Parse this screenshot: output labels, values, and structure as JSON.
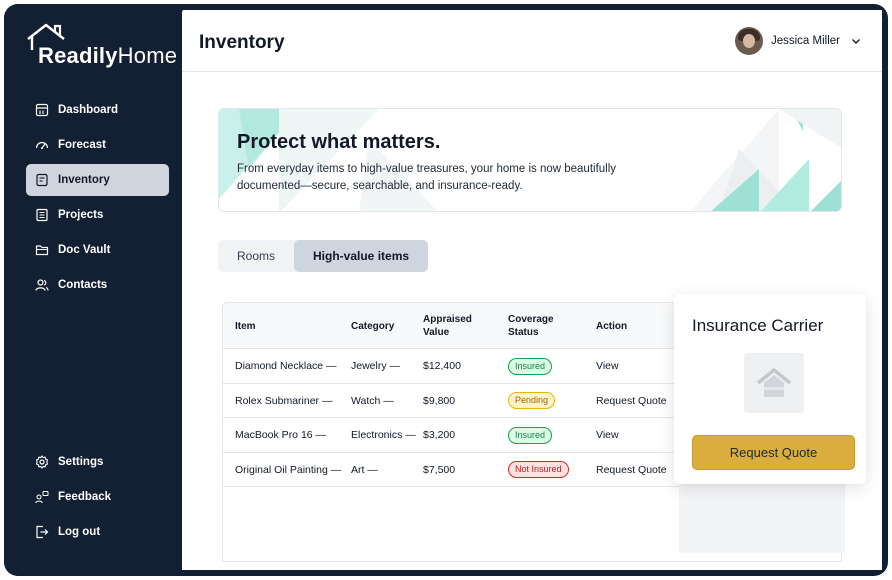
{
  "app": {
    "logo_text_bold": "Readily",
    "logo_text_light": "Home"
  },
  "sidebar": {
    "items": [
      {
        "label": "Dashboard",
        "icon": "calendar-icon",
        "active": false
      },
      {
        "label": "Forecast",
        "icon": "gauge-icon",
        "active": false
      },
      {
        "label": "Inventory",
        "icon": "inventory-icon",
        "active": true
      },
      {
        "label": "Projects",
        "icon": "projects-icon",
        "active": false
      },
      {
        "label": "Doc Vault",
        "icon": "folder-icon",
        "active": false
      },
      {
        "label": "Contacts",
        "icon": "contacts-icon",
        "active": false
      }
    ],
    "bottom_items": [
      {
        "label": "Settings",
        "icon": "gear-icon"
      },
      {
        "label": "Feedback",
        "icon": "feedback-icon"
      },
      {
        "label": "Log out",
        "icon": "logout-icon"
      }
    ]
  },
  "header": {
    "title": "Inventory",
    "user_name": "Jessica Miller"
  },
  "banner": {
    "title": "Protect what matters.",
    "text": "From everyday items to high-value treasures, your home is now beautifully documented—secure, searchable, and insurance-ready."
  },
  "tabs": [
    {
      "label": "Rooms",
      "active": false
    },
    {
      "label": "High-value items",
      "active": true
    }
  ],
  "table": {
    "headers": [
      "Item",
      "Category",
      "Appraised Value",
      "Coverage Status",
      "Action"
    ],
    "rows": [
      {
        "item": "Diamond Necklace —",
        "category": "Jewelry —",
        "value": "$12,400",
        "status": "Insured",
        "action": "View"
      },
      {
        "item": "Rolex Submariner —",
        "category": "Watch —",
        "value": "$9,800",
        "status": "Pending",
        "action": "Request Quote"
      },
      {
        "item": "MacBook Pro 16 —",
        "category": "Electronics —",
        "value": "$3,200",
        "status": "Insured",
        "action": "View"
      },
      {
        "item": "Original Oil Painting —",
        "category": "Art —",
        "value": "$7,500",
        "status": "Not Insured",
        "action": "Request Quote"
      }
    ]
  },
  "carrier": {
    "title": "Insurance Carrier",
    "button": "Request Quote"
  },
  "colors": {
    "sidebar_bg": "#131f33",
    "accent_gold": "#d9ae3e",
    "insured": "#16a34a",
    "pending": "#ca8a04",
    "not_insured": "#dc2626",
    "teal_deco": "#9fe0d4"
  }
}
